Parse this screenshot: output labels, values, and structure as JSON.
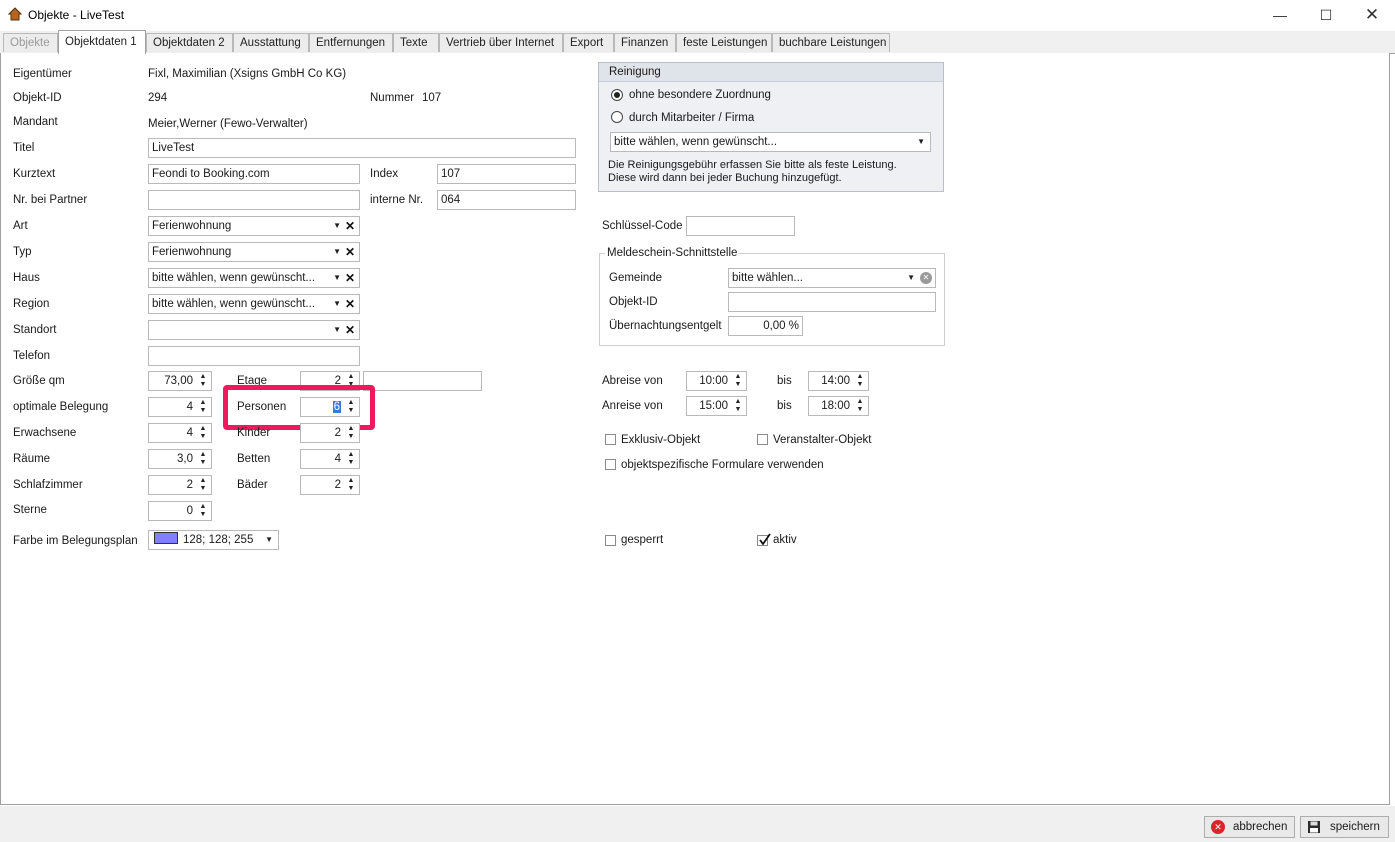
{
  "window": {
    "title": "Objekte - LiveTest"
  },
  "tabs": [
    {
      "label": "Objekte"
    },
    {
      "label": "Objektdaten 1"
    },
    {
      "label": "Objektdaten 2"
    },
    {
      "label": "Ausstattung"
    },
    {
      "label": "Entfernungen"
    },
    {
      "label": "Texte"
    },
    {
      "label": "Vertrieb über Internet"
    },
    {
      "label": "Export"
    },
    {
      "label": "Finanzen"
    },
    {
      "label": "feste Leistungen"
    },
    {
      "label": "buchbare Leistungen"
    }
  ],
  "form": {
    "eigentuemer_label": "Eigentümer",
    "eigentuemer_value": "Fixl, Maximilian (Xsigns GmbH Co KG)",
    "objektid_label": "Objekt-ID",
    "objektid_value": "294",
    "nummer_label": "Nummer",
    "nummer_value": "107",
    "mandant_label": "Mandant",
    "mandant_value": "Meier,Werner (Fewo-Verwalter)",
    "titel_label": "Titel",
    "titel_value": "LiveTest",
    "kurztext_label": "Kurztext",
    "kurztext_value": "Feondi to Booking.com",
    "index_label": "Index",
    "index_value": "107",
    "partner_label": "Nr. bei Partner",
    "partner_value": "",
    "interne_label": "interne Nr.",
    "interne_value": "064",
    "art_label": "Art",
    "art_value": "Ferienwohnung",
    "typ_label": "Typ",
    "typ_value": "Ferienwohnung",
    "haus_label": "Haus",
    "haus_value": "bitte wählen, wenn gewünscht...",
    "region_label": "Region",
    "region_value": "bitte wählen, wenn gewünscht...",
    "standort_label": "Standort",
    "standort_value": "",
    "telefon_label": "Telefon",
    "telefon_value": "",
    "groesse_label": "Größe qm",
    "groesse_value": "73,00",
    "etage_label": "Etage",
    "etage_value": "2",
    "belegung_label": "optimale Belegung",
    "belegung_value": "4",
    "personen_label": "Personen",
    "personen_value": "6",
    "erwachsene_label": "Erwachsene",
    "erwachsene_value": "4",
    "kinder_label": "Kinder",
    "kinder_value": "2",
    "raeume_label": "Räume",
    "raeume_value": "3,0",
    "betten_label": "Betten",
    "betten_value": "4",
    "schlafzimmer_label": "Schlafzimmer",
    "schlafzimmer_value": "2",
    "baeder_label": "Bäder",
    "baeder_value": "2",
    "sterne_label": "Sterne",
    "sterne_value": "0",
    "farbe_label": "Farbe im Belegungsplan",
    "farbe_value": "128; 128; 255",
    "farbe_color": "#8080ff"
  },
  "reinigung": {
    "title": "Reinigung",
    "option1": "ohne besondere Zuordnung",
    "option2": "durch Mitarbeiter / Firma",
    "select_value": "bitte wählen, wenn gewünscht...",
    "note1": "Die Reinigungsgebühr erfassen Sie bitte als feste Leistung.",
    "note2": "Diese wird dann bei jeder Buchung hinzugefügt."
  },
  "schluessel": {
    "label": "Schlüssel-Code",
    "value": ""
  },
  "meldeschein": {
    "title": "Meldeschein-Schnittstelle",
    "gemeinde_label": "Gemeinde",
    "gemeinde_value": "bitte wählen...",
    "objektid_label": "Objekt-ID",
    "objektid_value": "",
    "entgelt_label": "Übernachtungsentgelt",
    "entgelt_value": "0,00 %"
  },
  "zeiten": {
    "abreise_label": "Abreise von",
    "abreise_von": "10:00",
    "abreise_bis": "14:00",
    "anreise_label": "Anreise von",
    "anreise_von": "15:00",
    "anreise_bis": "18:00",
    "bis_label": "bis"
  },
  "checks": {
    "exklusiv": "Exklusiv-Objekt",
    "veranstalter": "Veranstalter-Objekt",
    "formulare": "objektspezifische Formulare verwenden",
    "gesperrt": "gesperrt",
    "aktiv": "aktiv"
  },
  "buttons": {
    "cancel": "abbrechen",
    "save": "speichern"
  },
  "colors": {
    "highlight": "#f0195f"
  }
}
